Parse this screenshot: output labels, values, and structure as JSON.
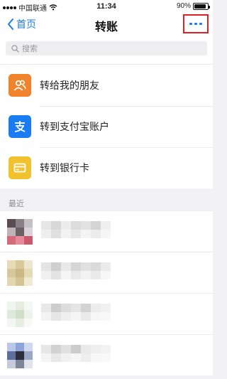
{
  "status_bar": {
    "carrier": "中国联通",
    "time": "11:34",
    "battery": "90%",
    "battery_level": 0.9
  },
  "nav": {
    "back_label": "首页",
    "title": "转账"
  },
  "search": {
    "placeholder": "搜索"
  },
  "menu": [
    {
      "label": "转给我的朋友",
      "icon": "friend-icon",
      "color": "#f0832b"
    },
    {
      "label": "转到支付宝账户",
      "icon": "alipay-icon",
      "color": "#1a7cf3"
    },
    {
      "label": "转到银行卡",
      "icon": "bank-card-icon",
      "color": "#f2c12e"
    }
  ],
  "recent": {
    "header": "最近"
  },
  "colors": {
    "accent": "#1a7cf3",
    "highlight_border": "#e02020"
  }
}
